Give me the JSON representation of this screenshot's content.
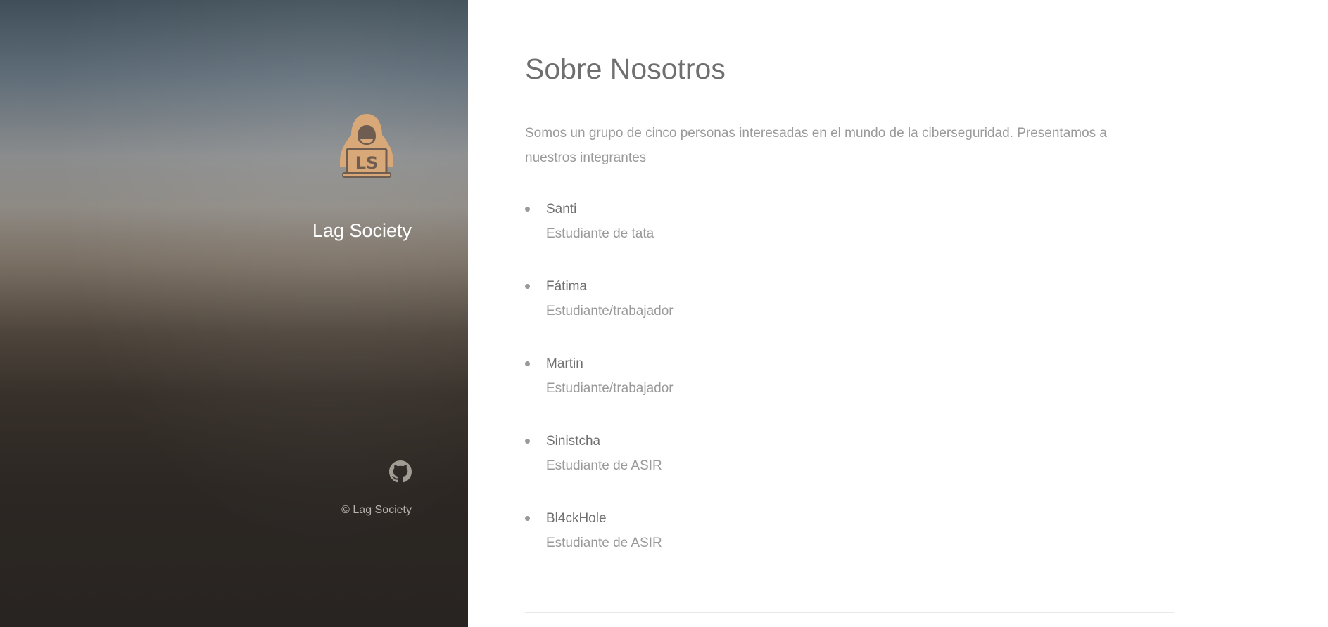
{
  "sidebar": {
    "logo_text": "LS",
    "site_title": "Lag Society",
    "github_label": "GitHub",
    "copyright": "© Lag Society",
    "logo_color": "#d9a878"
  },
  "main": {
    "title": "Sobre Nosotros",
    "intro": "Somos un grupo de cinco personas interesadas en el mundo de la ciberseguridad. Presentamos a nuestros integrantes",
    "members": [
      {
        "name": "Santi",
        "role": "Estudiante de tata"
      },
      {
        "name": "Fátima",
        "role": "Estudiante/trabajador"
      },
      {
        "name": "Martin",
        "role": "Estudiante/trabajador"
      },
      {
        "name": "Sinistcha",
        "role": "Estudiante de ASIR"
      },
      {
        "name": "Bl4ckHole",
        "role": "Estudiante de ASIR"
      }
    ]
  },
  "icons": {
    "logo": "hooded-hacker-icon",
    "github": "github-icon"
  }
}
